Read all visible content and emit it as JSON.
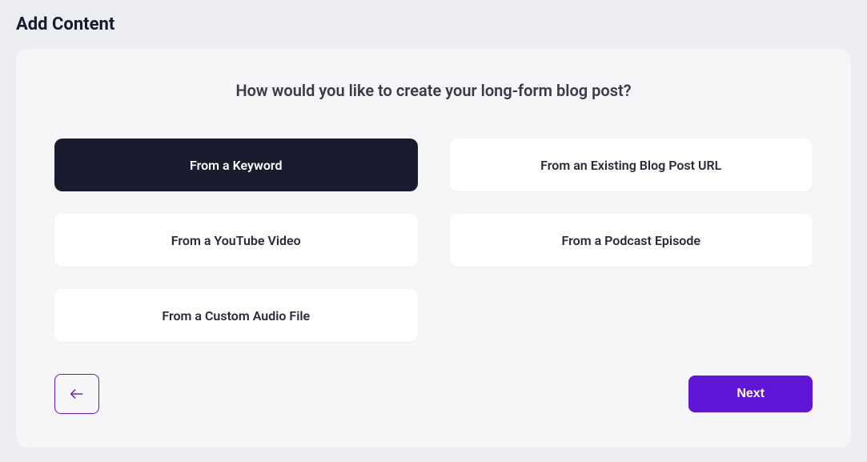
{
  "page_title": "Add Content",
  "question": "How would you like to create your long-form blog post?",
  "options": [
    {
      "label": "From a Keyword",
      "selected": true
    },
    {
      "label": "From an Existing Blog Post URL",
      "selected": false
    },
    {
      "label": "From a YouTube Video",
      "selected": false
    },
    {
      "label": "From a Podcast Episode",
      "selected": false
    },
    {
      "label": "From a Custom Audio File",
      "selected": false
    }
  ],
  "buttons": {
    "next": "Next"
  },
  "colors": {
    "accent": "#6016d6",
    "selected_bg": "#1b1b2f"
  }
}
